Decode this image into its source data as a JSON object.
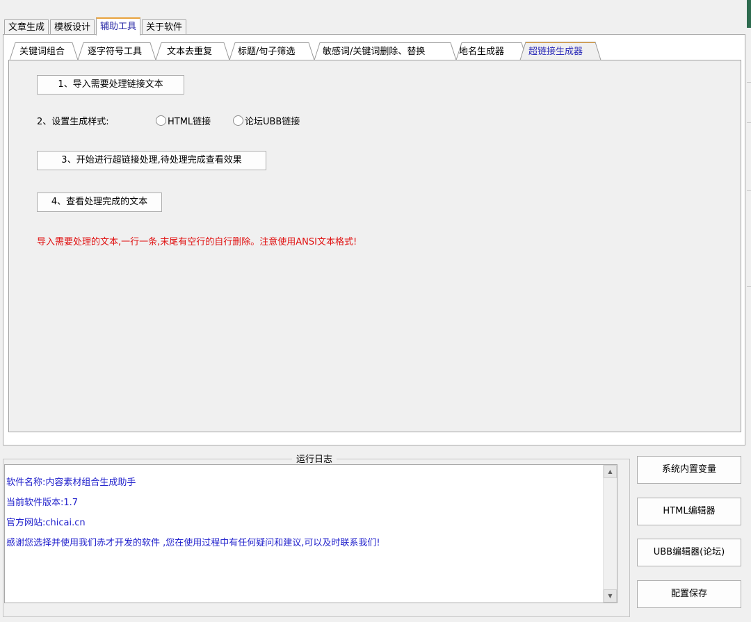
{
  "main_tabs": [
    {
      "label": "文章生成"
    },
    {
      "label": "模板设计"
    },
    {
      "label": "辅助工具"
    },
    {
      "label": "关于软件"
    }
  ],
  "active_main_tab": "辅助工具",
  "sub_tabs": [
    {
      "label": "关键词组合"
    },
    {
      "label": "逐字符号工具"
    },
    {
      "label": "文本去重复"
    },
    {
      "label": "标题/句子筛选"
    },
    {
      "label": "敏感词/关键词删除、替换"
    },
    {
      "label": "地名生成器"
    },
    {
      "label": "超链接生成器"
    }
  ],
  "active_sub_tab": "超链接生成器",
  "panel": {
    "step1_button": "1、导入需要处理链接文本",
    "step2_label": "2、设置生成样式:",
    "radio_html": "HTML链接",
    "radio_ubb": "论坛UBB链接",
    "step3_button": "3、开始进行超链接处理,待处理完成查看效果",
    "step4_button": "4、查看处理完成的文本",
    "warning": "导入需要处理的文本,一行一条,末尾有空行的自行删除。注意使用ANSI文本格式!"
  },
  "log": {
    "title": "运行日志",
    "lines": [
      "软件名称:内容素材组合生成助手",
      "当前软件版本:1.7",
      "官方网站:chicai.cn",
      "感谢您选择并使用我们赤才开发的软件 ,您在使用过程中有任何疑问和建议,可以及时联系我们!"
    ]
  },
  "side_buttons": {
    "vars": "系统内置变量",
    "html_editor": "HTML编辑器",
    "ubb_editor": "UBB编辑器(论坛)",
    "save": "配置保存"
  },
  "colors": {
    "active_tab_text": "#2a2aa6",
    "active_tab_accent": "#e8a23c",
    "warning_text": "#e01010",
    "log_text": "#2222cc"
  }
}
